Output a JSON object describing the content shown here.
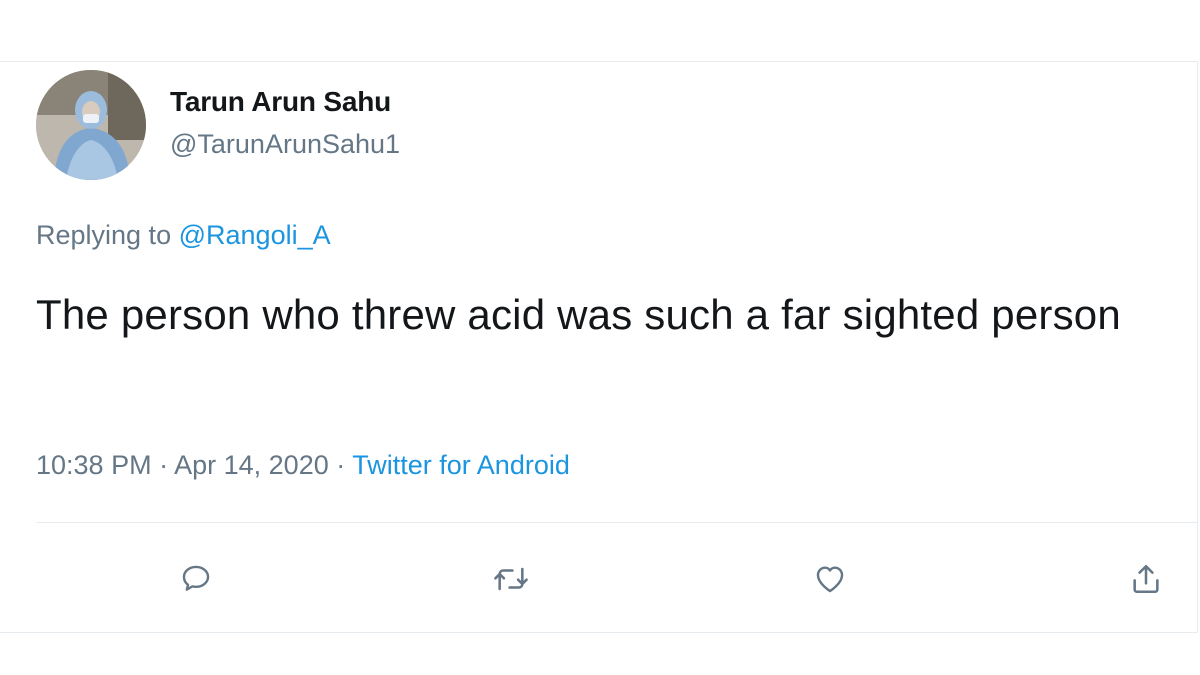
{
  "tweet": {
    "author": {
      "display_name": "Tarun Arun Sahu",
      "handle": "@TarunArunSahu1"
    },
    "replying_to": {
      "prefix": "Replying to",
      "mention": "@Rangoli_A"
    },
    "text": "The person who threw acid was such a far sighted person",
    "meta": {
      "time": "10:38 PM",
      "separator": "·",
      "date": "Apr 14, 2020",
      "source": "Twitter for Android"
    },
    "actions": {
      "reply_icon": "reply-icon",
      "retweet_icon": "retweet-icon",
      "like_icon": "heart-icon",
      "share_icon": "share-icon"
    }
  },
  "colors": {
    "text_primary": "#14171a",
    "text_secondary": "#657786",
    "link": "#1b95e0",
    "divider": "#e6ecf0"
  }
}
